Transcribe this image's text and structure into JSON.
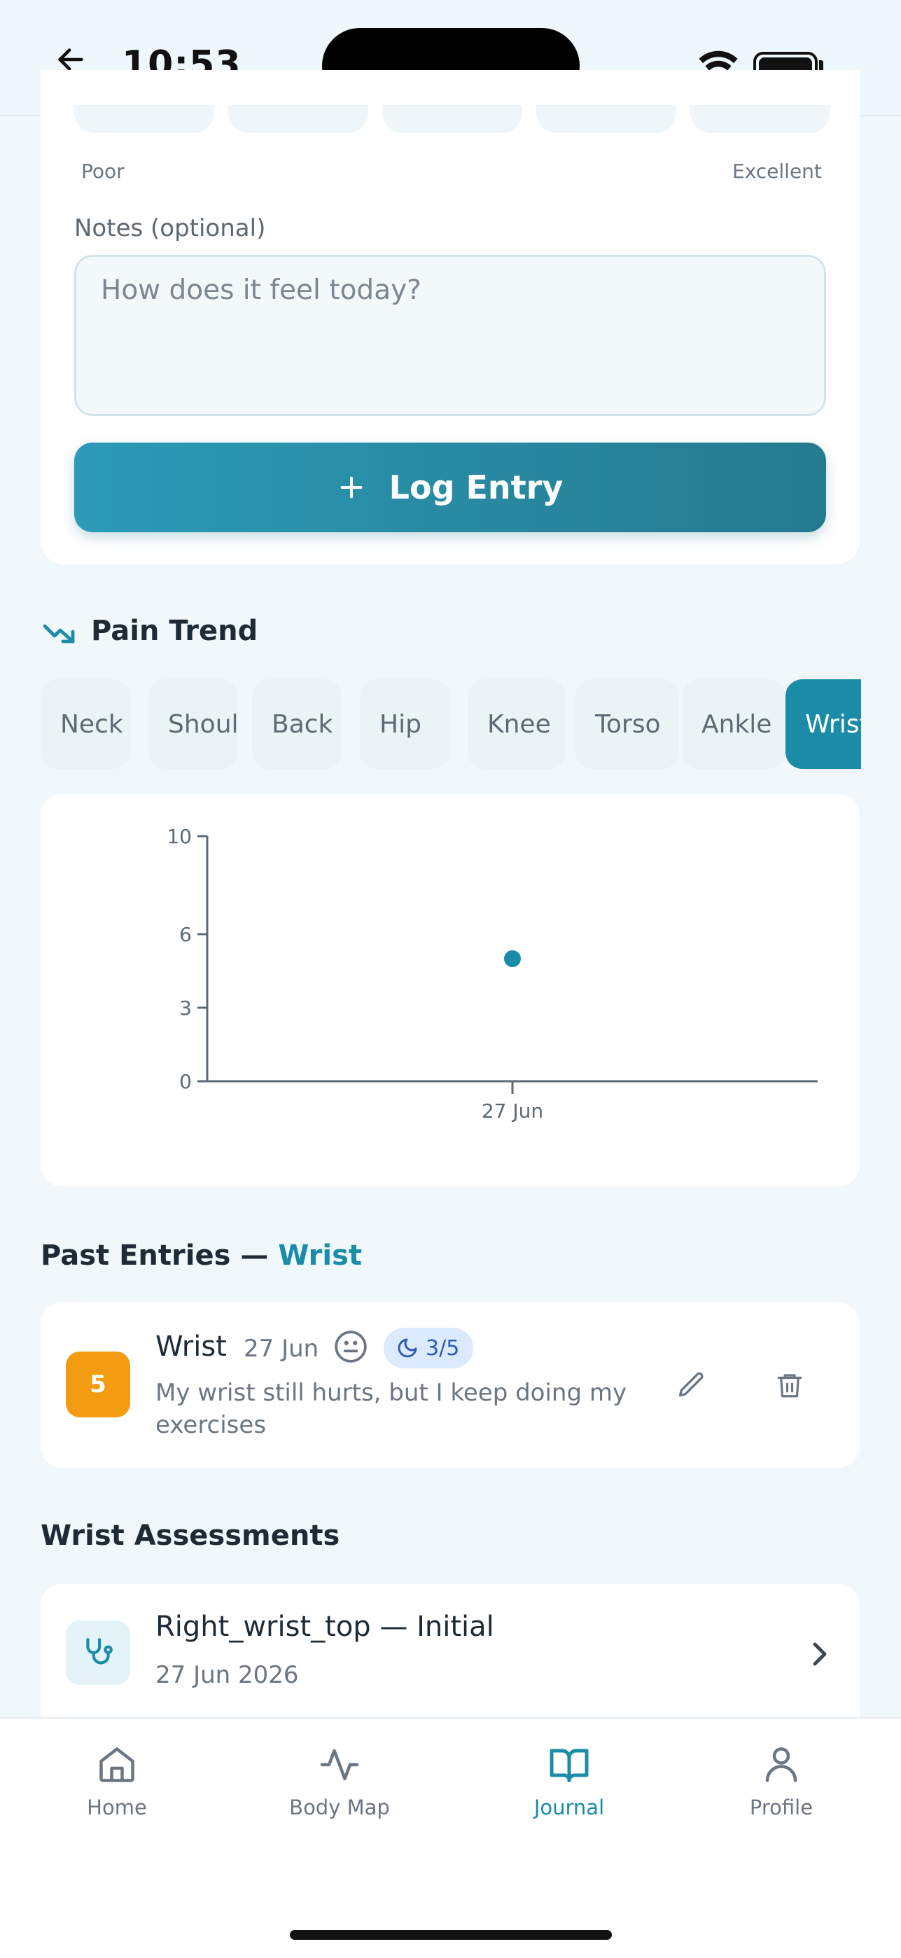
{
  "status_bar": {
    "time": "10:53"
  },
  "rating_scale": {
    "low_label": "Poor",
    "high_label": "Excellent"
  },
  "notes": {
    "label": "Notes (optional)",
    "placeholder": "How does it feel today?"
  },
  "log_button": {
    "label": "Log Entry"
  },
  "pain_trend": {
    "title": "Pain Trend",
    "chips": [
      {
        "label": "Neck",
        "active": false
      },
      {
        "label": "Shoulder",
        "active": false
      },
      {
        "label": "Back",
        "active": false
      },
      {
        "label": "Hip",
        "active": false
      },
      {
        "label": "Knee",
        "active": false
      },
      {
        "label": "Torso",
        "active": false
      },
      {
        "label": "Ankle",
        "active": false
      },
      {
        "label": "Wrist",
        "active": true
      }
    ]
  },
  "chart_data": {
    "type": "scatter",
    "title": "",
    "xlabel": "",
    "ylabel": "",
    "x_ticks": [
      "27 Jun"
    ],
    "y_ticks": [
      0,
      3,
      6,
      10
    ],
    "ylim": [
      0,
      10
    ],
    "points": [
      {
        "x": "27 Jun",
        "y": 5
      }
    ],
    "grid": false,
    "color": "#1a8ca8"
  },
  "past_entries": {
    "title_prefix": "Past Entries —",
    "title_region": "Wrist",
    "items": [
      {
        "score": "5",
        "region": "Wrist",
        "date": "27 Jun",
        "mood_icon": "neutral-face-icon",
        "sleep": "3/5",
        "note": "My wrist still hurts, but I keep doing my exercises"
      }
    ]
  },
  "assessments": {
    "title": "Wrist Assessments",
    "items": [
      {
        "name": "Right_wrist_top — Initial",
        "date": "27 Jun 2026"
      }
    ]
  },
  "bottom_nav": {
    "items": [
      {
        "label": "Home",
        "icon": "home-icon",
        "active": false
      },
      {
        "label": "Body Map",
        "icon": "activity-icon",
        "active": false
      },
      {
        "label": "Journal",
        "icon": "book-icon",
        "active": true
      },
      {
        "label": "Profile",
        "icon": "user-icon",
        "active": false
      }
    ]
  },
  "colors": {
    "accent": "#1a8ca8",
    "score_badge": "#f39c12",
    "sleep_badge_bg": "#dbeafe"
  }
}
